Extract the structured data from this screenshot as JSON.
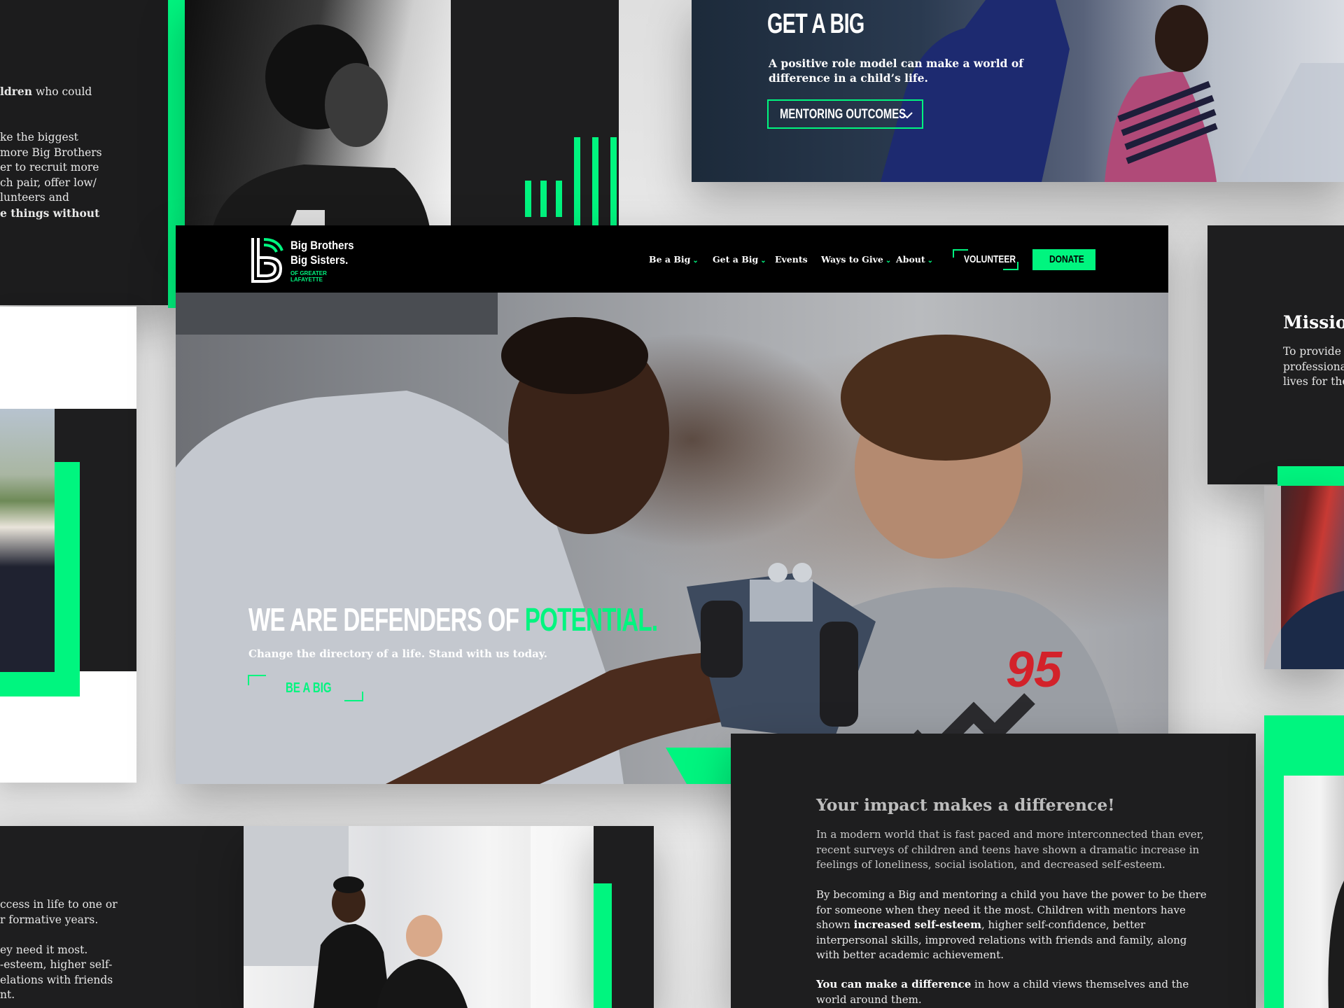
{
  "colors": {
    "accent": "#00f57f",
    "dark": "#1e1e1f",
    "nav_bg": "#000000"
  },
  "top_left_card": {
    "line1_bold": "ldren",
    "line1_rest": " who could",
    "para2_l1": "ke the biggest",
    "para2_l2": " more Big Brothers",
    "para2_l3": "er to recruit more",
    "para2_l4": "ch pair, offer low/",
    "para2_l5": "lunteers and",
    "para2_l6_bold": "e things without"
  },
  "get_a_big_card": {
    "title": "GET A BIG",
    "subtitle_l1": "A positive role model can make a world of",
    "subtitle_l2": "difference in a child’s life.",
    "button_label": "MENTORING OUTCOMES"
  },
  "header": {
    "logo_line1": "Big Brothers",
    "logo_line2": "Big Sisters.",
    "logo_sub1": "OF GREATER",
    "logo_sub2": "LAFAYETTE",
    "nav": [
      {
        "label": "Be a Big",
        "has_dropdown": true
      },
      {
        "label": "Get a Big",
        "has_dropdown": true
      },
      {
        "label": "Events",
        "has_dropdown": false
      },
      {
        "label": "Ways to Give",
        "has_dropdown": true
      },
      {
        "label": "About",
        "has_dropdown": true
      }
    ],
    "volunteer_label": "VOLUNTEER",
    "donate_label": "DONATE"
  },
  "hero": {
    "headline_white": "WE ARE DEFENDERS OF ",
    "headline_green": "POTENTIAL.",
    "subline": "Change the directory of a life. Stand with us today.",
    "cta_label": "BE A BIG",
    "shirt_number": "95"
  },
  "mission_card": {
    "title": "Missio",
    "l1": "To provide",
    "l2": "professiona",
    "l3": "lives for the"
  },
  "impact_card": {
    "title": "Your impact makes a difference!",
    "p1": "In a modern world that is fast paced and more interconnected than ever, recent surveys of children and teens have shown a dramatic increase in feelings of loneliness, social isolation, and decreased self-esteem.",
    "p2_a": "By becoming a Big and mentoring a child you have the power to be there for someone when they need it the most. Children with mentors have shown ",
    "p2_bold": "increased self-esteem",
    "p2_b": ", higher self-confidence, better interpersonal skills, improved relations with friends and family, along with better academic achievement.",
    "p3_bold": "You can make a difference",
    "p3_rest": " in how a child views themselves and the world around them."
  },
  "bottom_left_card": {
    "l1": "ccess in life to one or",
    "l2": "r formative years.",
    "l3": "ey need it most.",
    "l4": "-esteem, higher self-",
    "l5": "elations with friends",
    "l6": "nt."
  }
}
